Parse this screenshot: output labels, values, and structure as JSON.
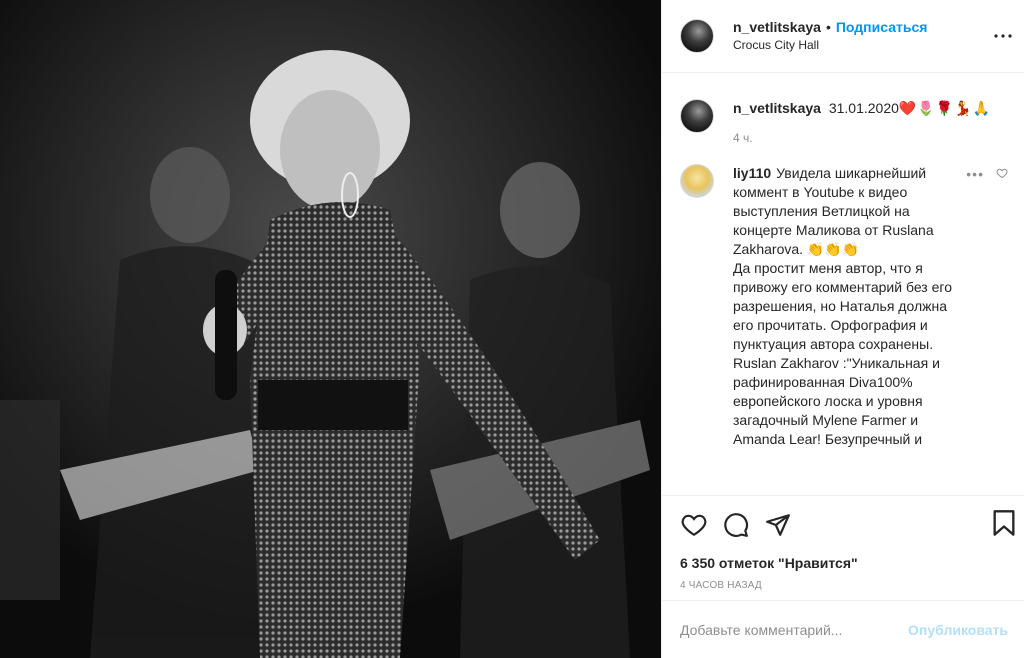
{
  "header": {
    "username": "n_vetlitskaya",
    "separator": "•",
    "follow_label": "Подписаться",
    "location": "Crocus City Hall"
  },
  "caption": {
    "username": "n_vetlitskaya",
    "text": "31.01.2020",
    "emojis": "❤️🌷🌹💃🙏",
    "time": "4 ч."
  },
  "comment": {
    "username": "liy110",
    "text": "Увидела шикарнейший коммент в Youtube к видео выступления Ветлицкой на концерте Маликова  от Ruslana Zakharova. 👏👏👏",
    "text2": "Да простит меня автор, что я привожу его комментарий без его разрешения, но Наталья должна его прочитать. Орфография и пунктуация автора сохранены. Ruslan Zakharov :\"Уникальная и рафинированная Diva100% европейского лоска и уровня загадочный Mylene Farmer и Amanda Lear! Безупречный и",
    "more": "•••"
  },
  "stats": {
    "likes": "6 350 отметок \"Нравится\"",
    "date": "4 часов назад"
  },
  "composer": {
    "placeholder": "Добавьте комментарий...",
    "publish_label": "Опубликовать"
  },
  "icons": {
    "header_more": "more-horizontal-icon",
    "like": "heart-icon",
    "comment": "comment-icon",
    "share": "share-icon",
    "save": "bookmark-icon",
    "comment_like": "heart-small-icon"
  },
  "colors": {
    "accent": "#0095f6",
    "publish_disabled": "#b2dffc",
    "muted": "#8e8e8e",
    "text": "#262626"
  }
}
